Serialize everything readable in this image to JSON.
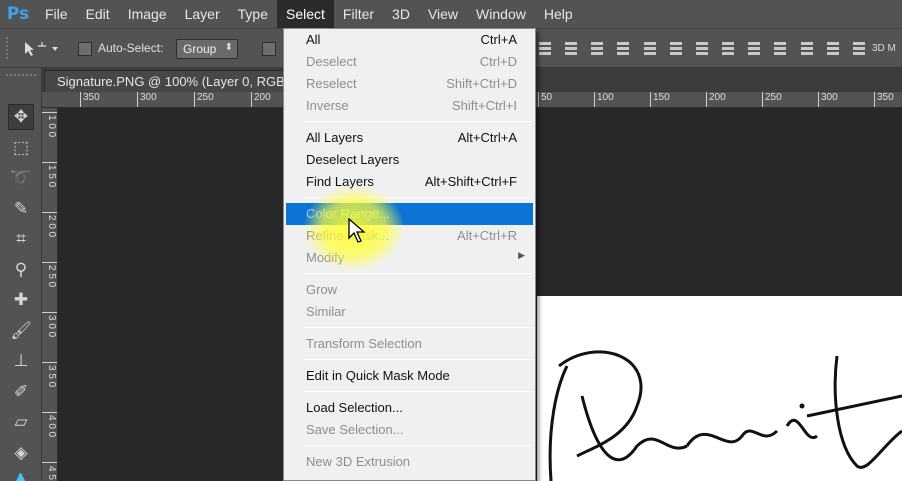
{
  "app": {
    "logo": "Ps"
  },
  "menubar": {
    "items": [
      "File",
      "Edit",
      "Image",
      "Layer",
      "Type",
      "Select",
      "Filter",
      "3D",
      "View",
      "Window",
      "Help"
    ],
    "active": "Select"
  },
  "options": {
    "auto_select_label": "Auto-Select:",
    "auto_select_value": "Group",
    "right_label": "3D M"
  },
  "document": {
    "tab_title": "Signature.PNG @ 100% (Layer 0, RGB/"
  },
  "rulers": {
    "top_ticks_left": [
      "350",
      "300",
      "250",
      "200"
    ],
    "top_ticks_right": [
      "50",
      "100",
      "150",
      "200",
      "250",
      "300",
      "350"
    ],
    "left_ticks": [
      "1 0 0",
      "1 5 0",
      "2 0 0",
      "2 5 0",
      "3 0 0",
      "3 5 0",
      "4 0 0",
      "4 5 0"
    ]
  },
  "select_menu": {
    "groups": [
      [
        {
          "label": "All",
          "shortcut": "Ctrl+A",
          "disabled": false
        },
        {
          "label": "Deselect",
          "shortcut": "Ctrl+D",
          "disabled": true
        },
        {
          "label": "Reselect",
          "shortcut": "Shift+Ctrl+D",
          "disabled": true
        },
        {
          "label": "Inverse",
          "shortcut": "Shift+Ctrl+I",
          "disabled": true
        }
      ],
      [
        {
          "label": "All Layers",
          "shortcut": "Alt+Ctrl+A",
          "disabled": false
        },
        {
          "label": "Deselect Layers",
          "shortcut": "",
          "disabled": false
        },
        {
          "label": "Find Layers",
          "shortcut": "Alt+Shift+Ctrl+F",
          "disabled": false
        }
      ],
      [
        {
          "label": "Color Range...",
          "shortcut": "",
          "disabled": false,
          "highlighted": true
        },
        {
          "label": "Refine Mask...",
          "shortcut": "Alt+Ctrl+R",
          "disabled": true
        },
        {
          "label": "Modify",
          "shortcut": "",
          "disabled": true,
          "submenu": true
        }
      ],
      [
        {
          "label": "Grow",
          "shortcut": "",
          "disabled": true
        },
        {
          "label": "Similar",
          "shortcut": "",
          "disabled": true
        }
      ],
      [
        {
          "label": "Transform Selection",
          "shortcut": "",
          "disabled": true
        }
      ],
      [
        {
          "label": "Edit in Quick Mask Mode",
          "shortcut": "",
          "disabled": false
        }
      ],
      [
        {
          "label": "Load Selection...",
          "shortcut": "",
          "disabled": false
        },
        {
          "label": "Save Selection...",
          "shortcut": "",
          "disabled": true
        }
      ],
      [
        {
          "label": "New 3D Extrusion",
          "shortcut": "",
          "disabled": true
        }
      ]
    ]
  },
  "tools": [
    {
      "name": "move-tool-icon",
      "glyph": "✥",
      "selected": true
    },
    {
      "name": "marquee-tool-icon",
      "glyph": "⬚"
    },
    {
      "name": "lasso-tool-icon",
      "glyph": "➰"
    },
    {
      "name": "quick-select-tool-icon",
      "glyph": "✎"
    },
    {
      "name": "crop-tool-icon",
      "glyph": "⌗"
    },
    {
      "name": "eyedropper-tool-icon",
      "glyph": "⚲"
    },
    {
      "name": "healing-brush-tool-icon",
      "glyph": "✚"
    },
    {
      "name": "brush-tool-icon",
      "glyph": "🖌"
    },
    {
      "name": "clone-stamp-tool-icon",
      "glyph": "⊥"
    },
    {
      "name": "history-brush-tool-icon",
      "glyph": "✐"
    },
    {
      "name": "eraser-tool-icon",
      "glyph": "▱"
    },
    {
      "name": "paint-bucket-tool-icon",
      "glyph": "◈"
    },
    {
      "name": "blur-tool-icon",
      "glyph": "💧"
    }
  ]
}
